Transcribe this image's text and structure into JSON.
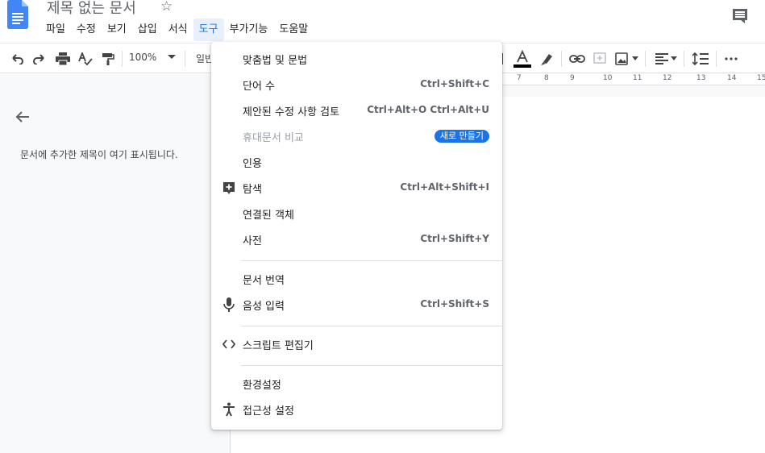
{
  "header": {
    "title": "제목 없는 문서"
  },
  "menubar": {
    "items": [
      "파일",
      "수정",
      "보기",
      "삽입",
      "서식",
      "도구",
      "부가기능",
      "도움말"
    ],
    "active_index": 5
  },
  "toolbar": {
    "zoom": "100%",
    "style_partial": "일반"
  },
  "ruler": {
    "labels": [
      "7",
      "8",
      "9",
      "10",
      "11",
      "12",
      "13",
      "14",
      "15"
    ]
  },
  "outline": {
    "hint": "문서에 추가한 제목이 여기 표시됩니다."
  },
  "tools_menu": {
    "items": [
      {
        "label": "맞춤법 및 문법",
        "shortcut": "",
        "icon": ""
      },
      {
        "label": "단어 수",
        "shortcut": "Ctrl+Shift+C",
        "icon": ""
      },
      {
        "label": "제안된 수정 사항 검토",
        "shortcut": "Ctrl+Alt+O Ctrl+Alt+U",
        "icon": ""
      },
      {
        "label": "휴대문서 비교",
        "shortcut": "",
        "badge": "새로 만들기",
        "icon": "",
        "disabled": true
      },
      {
        "label": "인용",
        "shortcut": "",
        "icon": ""
      },
      {
        "label": "탐색",
        "shortcut": "Ctrl+Alt+Shift+I",
        "icon": "explore-icon"
      },
      {
        "label": "연결된 객체",
        "shortcut": "",
        "icon": ""
      },
      {
        "label": "사전",
        "shortcut": "Ctrl+Shift+Y",
        "icon": ""
      },
      {
        "label": "문서 번역",
        "shortcut": "",
        "icon": ""
      },
      {
        "label": "음성 입력",
        "shortcut": "Ctrl+Shift+S",
        "icon": "microphone-icon"
      },
      {
        "label": "스크립트 편집기",
        "shortcut": "",
        "icon": "code-icon"
      },
      {
        "label": "환경설정",
        "shortcut": "",
        "icon": ""
      },
      {
        "label": "접근성 설정",
        "shortcut": "",
        "icon": "accessibility-icon"
      }
    ]
  },
  "colors": {
    "accent": "#1a73e8",
    "doc_icon": "#4285f4"
  }
}
